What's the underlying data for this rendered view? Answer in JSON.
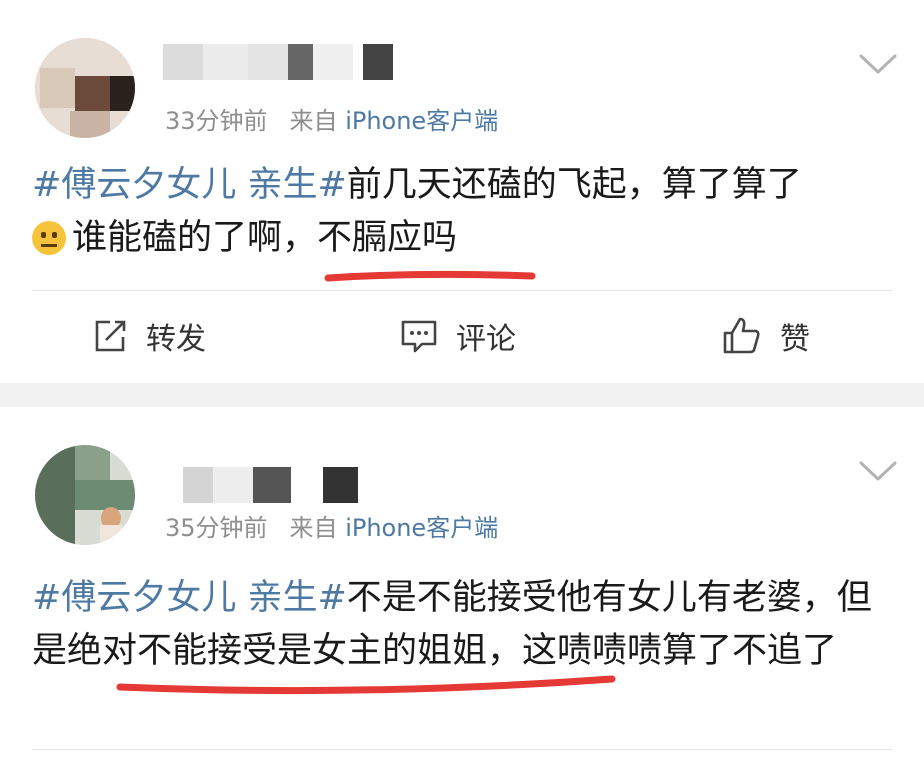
{
  "posts": [
    {
      "time": "33分钟前",
      "source_prefix": "来自",
      "device": "iPhone客户端",
      "tag": "#傅云夕女儿 亲生#",
      "text_a": "前几天还磕的飞起，算了算了",
      "text_b": "谁能磕的了啊，",
      "text_c": "不膈应吗",
      "emoji": "neutral-face-emoji"
    },
    {
      "time": "35分钟前",
      "source_prefix": "来自",
      "device": "iPhone客户端",
      "tag": "#傅云夕女儿 亲生#",
      "text_a": "不是不能接受他有女儿有老婆，",
      "text_b": "但是",
      "text_c": "绝对不能接受是女主的姐姐，",
      "text_d": "这啧啧啧算了不追了"
    }
  ],
  "actions": {
    "repost": "转发",
    "comment": "评论",
    "like": "赞"
  },
  "colors": {
    "topic": "#4d79a3",
    "underline": "#e53935",
    "meta": "#8e8e8e",
    "separator": "#f2f2f2"
  }
}
